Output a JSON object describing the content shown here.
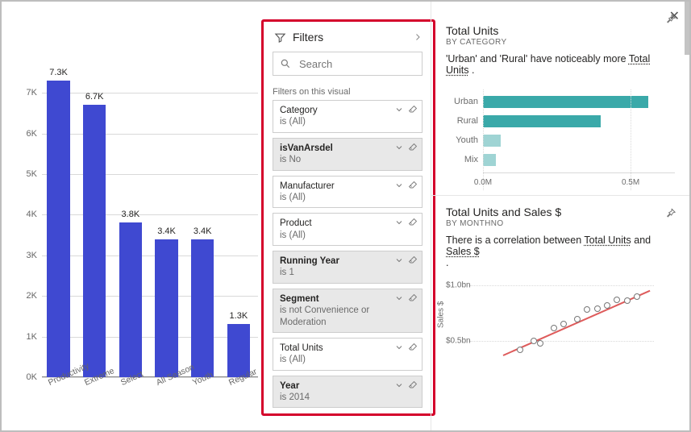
{
  "chart_data": [
    {
      "type": "bar",
      "categories": [
        "Productivity",
        "Extreme",
        "Select",
        "All Season",
        "Youth",
        "Regular"
      ],
      "values": [
        7300,
        6700,
        3800,
        3400,
        3400,
        1300
      ],
      "display_labels": [
        "7.3K",
        "6.7K",
        "3.8K",
        "3.4K",
        "3.4K",
        "1.3K"
      ],
      "ylim": [
        0,
        7500
      ],
      "yticks": [
        0,
        1000,
        2000,
        3000,
        4000,
        5000,
        6000,
        7000
      ],
      "ytick_labels": [
        "0K",
        "1K",
        "2K",
        "3K",
        "4K",
        "5K",
        "6K",
        "7K"
      ]
    },
    {
      "type": "bar",
      "orientation": "horizontal",
      "title": "Total Units",
      "subtitle": "BY CATEGORY",
      "description_parts": [
        "'Urban' and 'Rural' have noticeably more ",
        "Total Units",
        " ."
      ],
      "categories": [
        "Urban",
        "Rural",
        "Youth",
        "Mix"
      ],
      "values": [
        560000,
        400000,
        60000,
        45000
      ],
      "xticks": [
        0,
        500000
      ],
      "xtick_labels": [
        "0.0M",
        "0.5M"
      ],
      "xlim": [
        0,
        650000
      ]
    },
    {
      "type": "scatter",
      "title": "Total Units and Sales $",
      "subtitle": "BY MONTHNO",
      "description_parts": [
        "There is a correlation between ",
        "Total Units",
        " and ",
        "Sales $"
      ],
      "ylabel": "Sales $",
      "yticks": [
        500000000,
        1000000000
      ],
      "ytick_labels": [
        "$0.5bn",
        "$1.0bn"
      ],
      "xlim": [
        0,
        1100000
      ],
      "ylim": [
        300000000,
        1050000000
      ],
      "points": [
        {
          "x": 300000,
          "y": 420000000
        },
        {
          "x": 380000,
          "y": 500000000
        },
        {
          "x": 420000,
          "y": 480000000
        },
        {
          "x": 500000,
          "y": 620000000
        },
        {
          "x": 560000,
          "y": 650000000
        },
        {
          "x": 640000,
          "y": 700000000
        },
        {
          "x": 700000,
          "y": 780000000
        },
        {
          "x": 760000,
          "y": 790000000
        },
        {
          "x": 820000,
          "y": 820000000
        },
        {
          "x": 880000,
          "y": 870000000
        },
        {
          "x": 940000,
          "y": 860000000
        },
        {
          "x": 1000000,
          "y": 900000000
        }
      ],
      "trend": {
        "x0": 200000,
        "y0": 380000000,
        "x1": 1080000,
        "y1": 960000000
      }
    }
  ],
  "filters": {
    "title": "Filters",
    "search_placeholder": "Search",
    "section_label": "Filters on this visual",
    "cards": [
      {
        "name": "Category",
        "state": "is (All)",
        "active": false
      },
      {
        "name": "isVanArsdel",
        "state": "is No",
        "active": true
      },
      {
        "name": "Manufacturer",
        "state": "is (All)",
        "active": false
      },
      {
        "name": "Product",
        "state": "is (All)",
        "active": false
      },
      {
        "name": "Running Year",
        "state": "is 1",
        "active": true
      },
      {
        "name": "Segment",
        "state": "is not Convenience or Moderation",
        "active": true
      },
      {
        "name": "Total Units",
        "state": "is (All)",
        "active": false
      },
      {
        "name": "Year",
        "state": "is 2014",
        "active": true
      }
    ]
  }
}
